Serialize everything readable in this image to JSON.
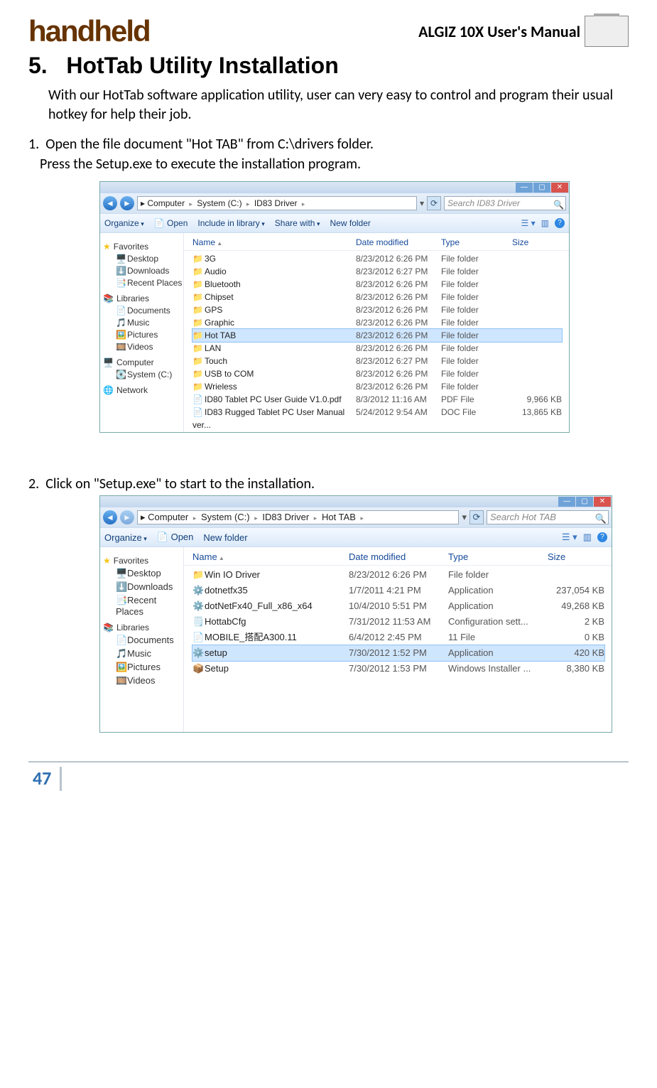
{
  "brand": "handheld",
  "doc_title": "ALGIZ 10X User's Manual",
  "section_num": "5.",
  "section_title": "HotTab Utility Installation",
  "intro": "With our HotTab software application utility, user can very easy to control and program their usual hotkey for help their job.",
  "step1_num": "1.",
  "step1": "Open the file document \"Hot TAB\" from C:\\drivers folder.",
  "step1b": "Press the Setup.exe to execute the installation program.",
  "step2_num": "2.",
  "step2": "Click on \"Setup.exe\" to start to the installation.",
  "page_number": "47",
  "explorer1": {
    "breadcrumbs": [
      "Computer",
      "System (C:)",
      "ID83 Driver"
    ],
    "search_placeholder": "Search ID83 Driver",
    "toolbar": {
      "organize": "Organize",
      "open": "Open",
      "include": "Include in library",
      "share": "Share with",
      "new": "New folder"
    },
    "cols": {
      "name": "Name",
      "date": "Date modified",
      "type": "Type",
      "size": "Size"
    },
    "nav": {
      "favorites": "Favorites",
      "fav_items": [
        "Desktop",
        "Downloads",
        "Recent Places"
      ],
      "libraries": "Libraries",
      "lib_items": [
        "Documents",
        "Music",
        "Pictures",
        "Videos"
      ],
      "computer": "Computer",
      "comp_items": [
        "System (C:)"
      ],
      "network": "Network"
    },
    "rows": [
      {
        "name": "3G",
        "date": "8/23/2012 6:26 PM",
        "type": "File folder",
        "size": "",
        "cls": "folder"
      },
      {
        "name": "Audio",
        "date": "8/23/2012 6:27 PM",
        "type": "File folder",
        "size": "",
        "cls": "folder"
      },
      {
        "name": "Bluetooth",
        "date": "8/23/2012 6:26 PM",
        "type": "File folder",
        "size": "",
        "cls": "folder"
      },
      {
        "name": "Chipset",
        "date": "8/23/2012 6:26 PM",
        "type": "File folder",
        "size": "",
        "cls": "folder"
      },
      {
        "name": "GPS",
        "date": "8/23/2012 6:26 PM",
        "type": "File folder",
        "size": "",
        "cls": "folder"
      },
      {
        "name": "Graphic",
        "date": "8/23/2012 6:26 PM",
        "type": "File folder",
        "size": "",
        "cls": "folder"
      },
      {
        "name": "Hot TAB",
        "date": "8/23/2012 6:26 PM",
        "type": "File folder",
        "size": "",
        "cls": "folder",
        "sel": true
      },
      {
        "name": "LAN",
        "date": "8/23/2012 6:26 PM",
        "type": "File folder",
        "size": "",
        "cls": "folder"
      },
      {
        "name": "Touch",
        "date": "8/23/2012 6:27 PM",
        "type": "File folder",
        "size": "",
        "cls": "folder"
      },
      {
        "name": "USB to COM",
        "date": "8/23/2012 6:26 PM",
        "type": "File folder",
        "size": "",
        "cls": "folder"
      },
      {
        "name": "Wrieless",
        "date": "8/23/2012 6:26 PM",
        "type": "File folder",
        "size": "",
        "cls": "folder"
      },
      {
        "name": "ID80 Tablet PC User Guide V1.0.pdf",
        "date": "8/3/2012 11:16 AM",
        "type": "PDF File",
        "size": "9,966 KB",
        "cls": "pdf"
      },
      {
        "name": "ID83 Rugged Tablet PC  User Manual ver...",
        "date": "5/24/2012 9:54 AM",
        "type": "DOC File",
        "size": "13,865 KB",
        "cls": "doc"
      }
    ]
  },
  "explorer2": {
    "breadcrumbs": [
      "Computer",
      "System (C:)",
      "ID83 Driver",
      "Hot TAB"
    ],
    "search_placeholder": "Search Hot TAB",
    "toolbar": {
      "organize": "Organize",
      "open": "Open",
      "new": "New folder"
    },
    "cols": {
      "name": "Name",
      "date": "Date modified",
      "type": "Type",
      "size": "Size"
    },
    "nav": {
      "favorites": "Favorites",
      "fav_items": [
        "Desktop",
        "Downloads",
        "Recent Places"
      ],
      "libraries": "Libraries",
      "lib_items": [
        "Documents",
        "Music",
        "Pictures",
        "Videos"
      ]
    },
    "rows": [
      {
        "name": "Win IO Driver",
        "date": "8/23/2012 6:26 PM",
        "type": "File folder",
        "size": "",
        "cls": "folder"
      },
      {
        "name": "dotnetfx35",
        "date": "1/7/2011 4:21 PM",
        "type": "Application",
        "size": "237,054 KB",
        "cls": "app"
      },
      {
        "name": "dotNetFx40_Full_x86_x64",
        "date": "10/4/2010 5:51 PM",
        "type": "Application",
        "size": "49,268 KB",
        "cls": "app"
      },
      {
        "name": "HottabCfg",
        "date": "7/31/2012 11:53 AM",
        "type": "Configuration sett...",
        "size": "2 KB",
        "cls": "cfg"
      },
      {
        "name": "MOBILE_搭配A300.11",
        "date": "6/4/2012 2:45 PM",
        "type": "11 File",
        "size": "0 KB",
        "cls": "doc"
      },
      {
        "name": "setup",
        "date": "7/30/2012 1:52 PM",
        "type": "Application",
        "size": "420 KB",
        "cls": "app",
        "sel": true
      },
      {
        "name": "Setup",
        "date": "7/30/2012 1:53 PM",
        "type": "Windows Installer ...",
        "size": "8,380 KB",
        "cls": "msi"
      }
    ]
  }
}
